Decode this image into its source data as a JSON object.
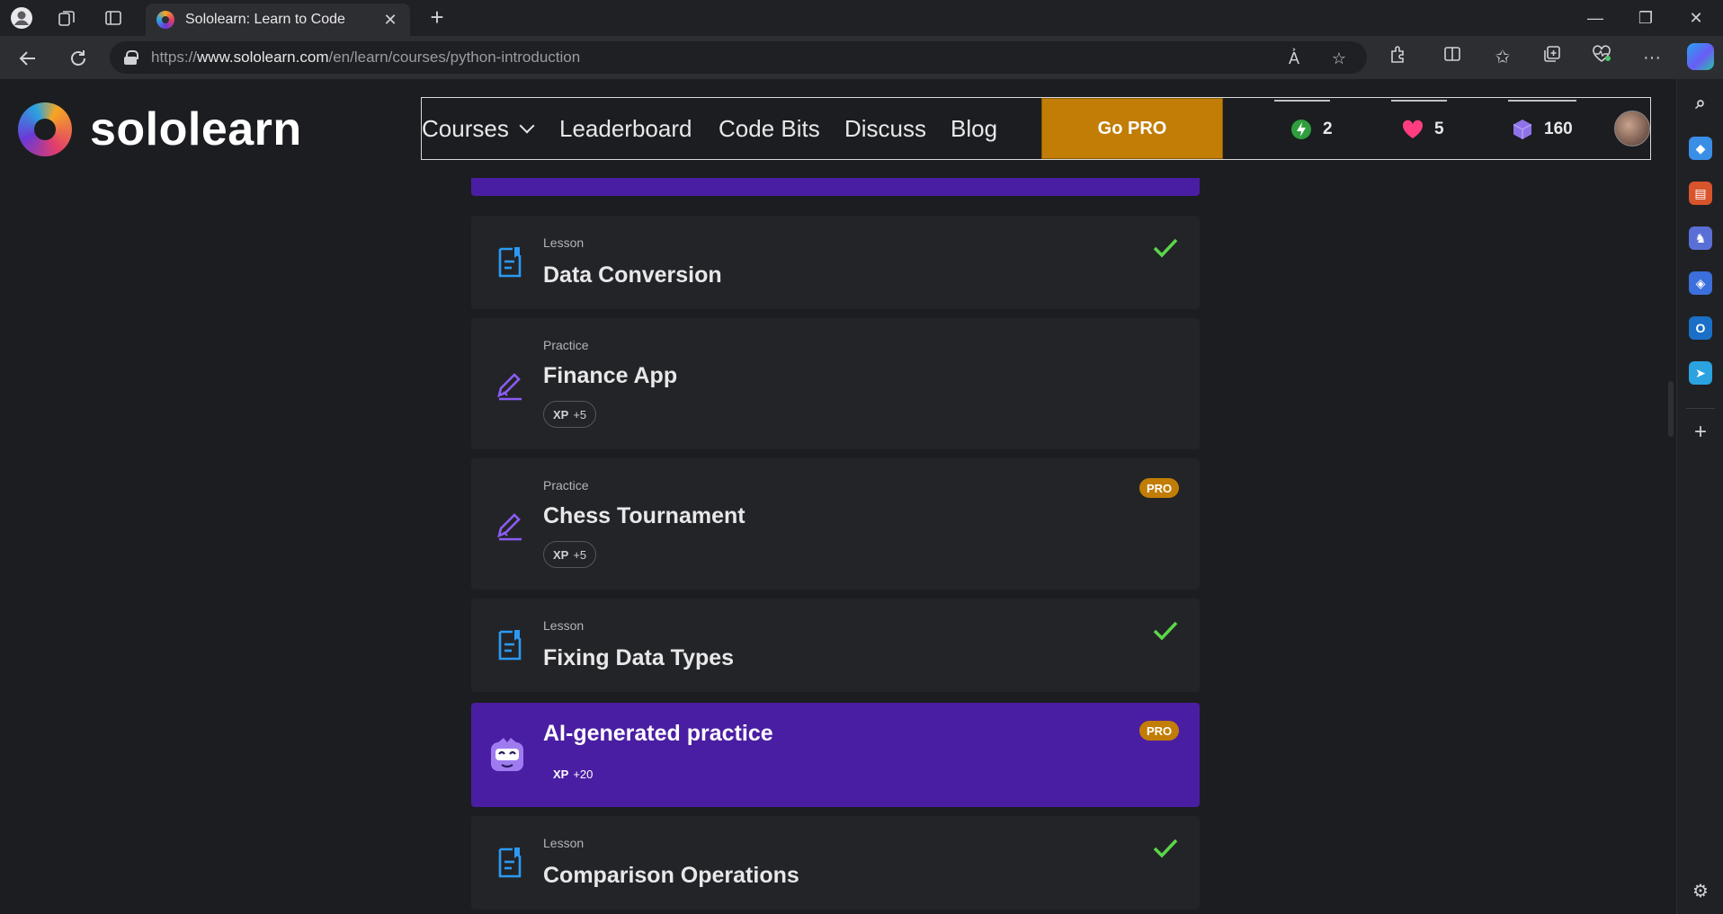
{
  "browser": {
    "tab_title": "Sololearn: Learn to Code",
    "url_prefix": "https://",
    "url_host": "www.sololearn.com",
    "url_path": "/en/learn/courses/python-introduction"
  },
  "site": {
    "logo_text": "sololearn",
    "nav": {
      "courses": "Courses",
      "leaderboard": "Leaderboard",
      "code_bits": "Code Bits",
      "discuss": "Discuss",
      "blog": "Blog",
      "go_pro": "Go PRO"
    },
    "stats": {
      "streak": "2",
      "hearts": "5",
      "bits": "160"
    },
    "colors": {
      "accent_orange": "#c17d05",
      "purple": "#4a1ea3",
      "lesson_blue": "#2b9af3",
      "practice_purple": "#8b5cf6",
      "check_green": "#5bd64a"
    }
  },
  "course_items": [
    {
      "type": "Lesson",
      "name": "Data Conversion",
      "completed": true
    },
    {
      "type": "Practice",
      "name": "Finance App",
      "xp_label": "XP",
      "xp_value": "+5"
    },
    {
      "type": "Practice",
      "name": "Chess Tournament",
      "xp_label": "XP",
      "xp_value": "+5",
      "badge": "PRO"
    },
    {
      "type": "Lesson",
      "name": "Fixing Data Types",
      "completed": true
    },
    {
      "name": "AI-generated practice",
      "xp_label": "XP",
      "xp_value": "+20",
      "badge": "PRO"
    },
    {
      "type": "Lesson",
      "name": "Comparison Operations",
      "completed": true
    }
  ]
}
